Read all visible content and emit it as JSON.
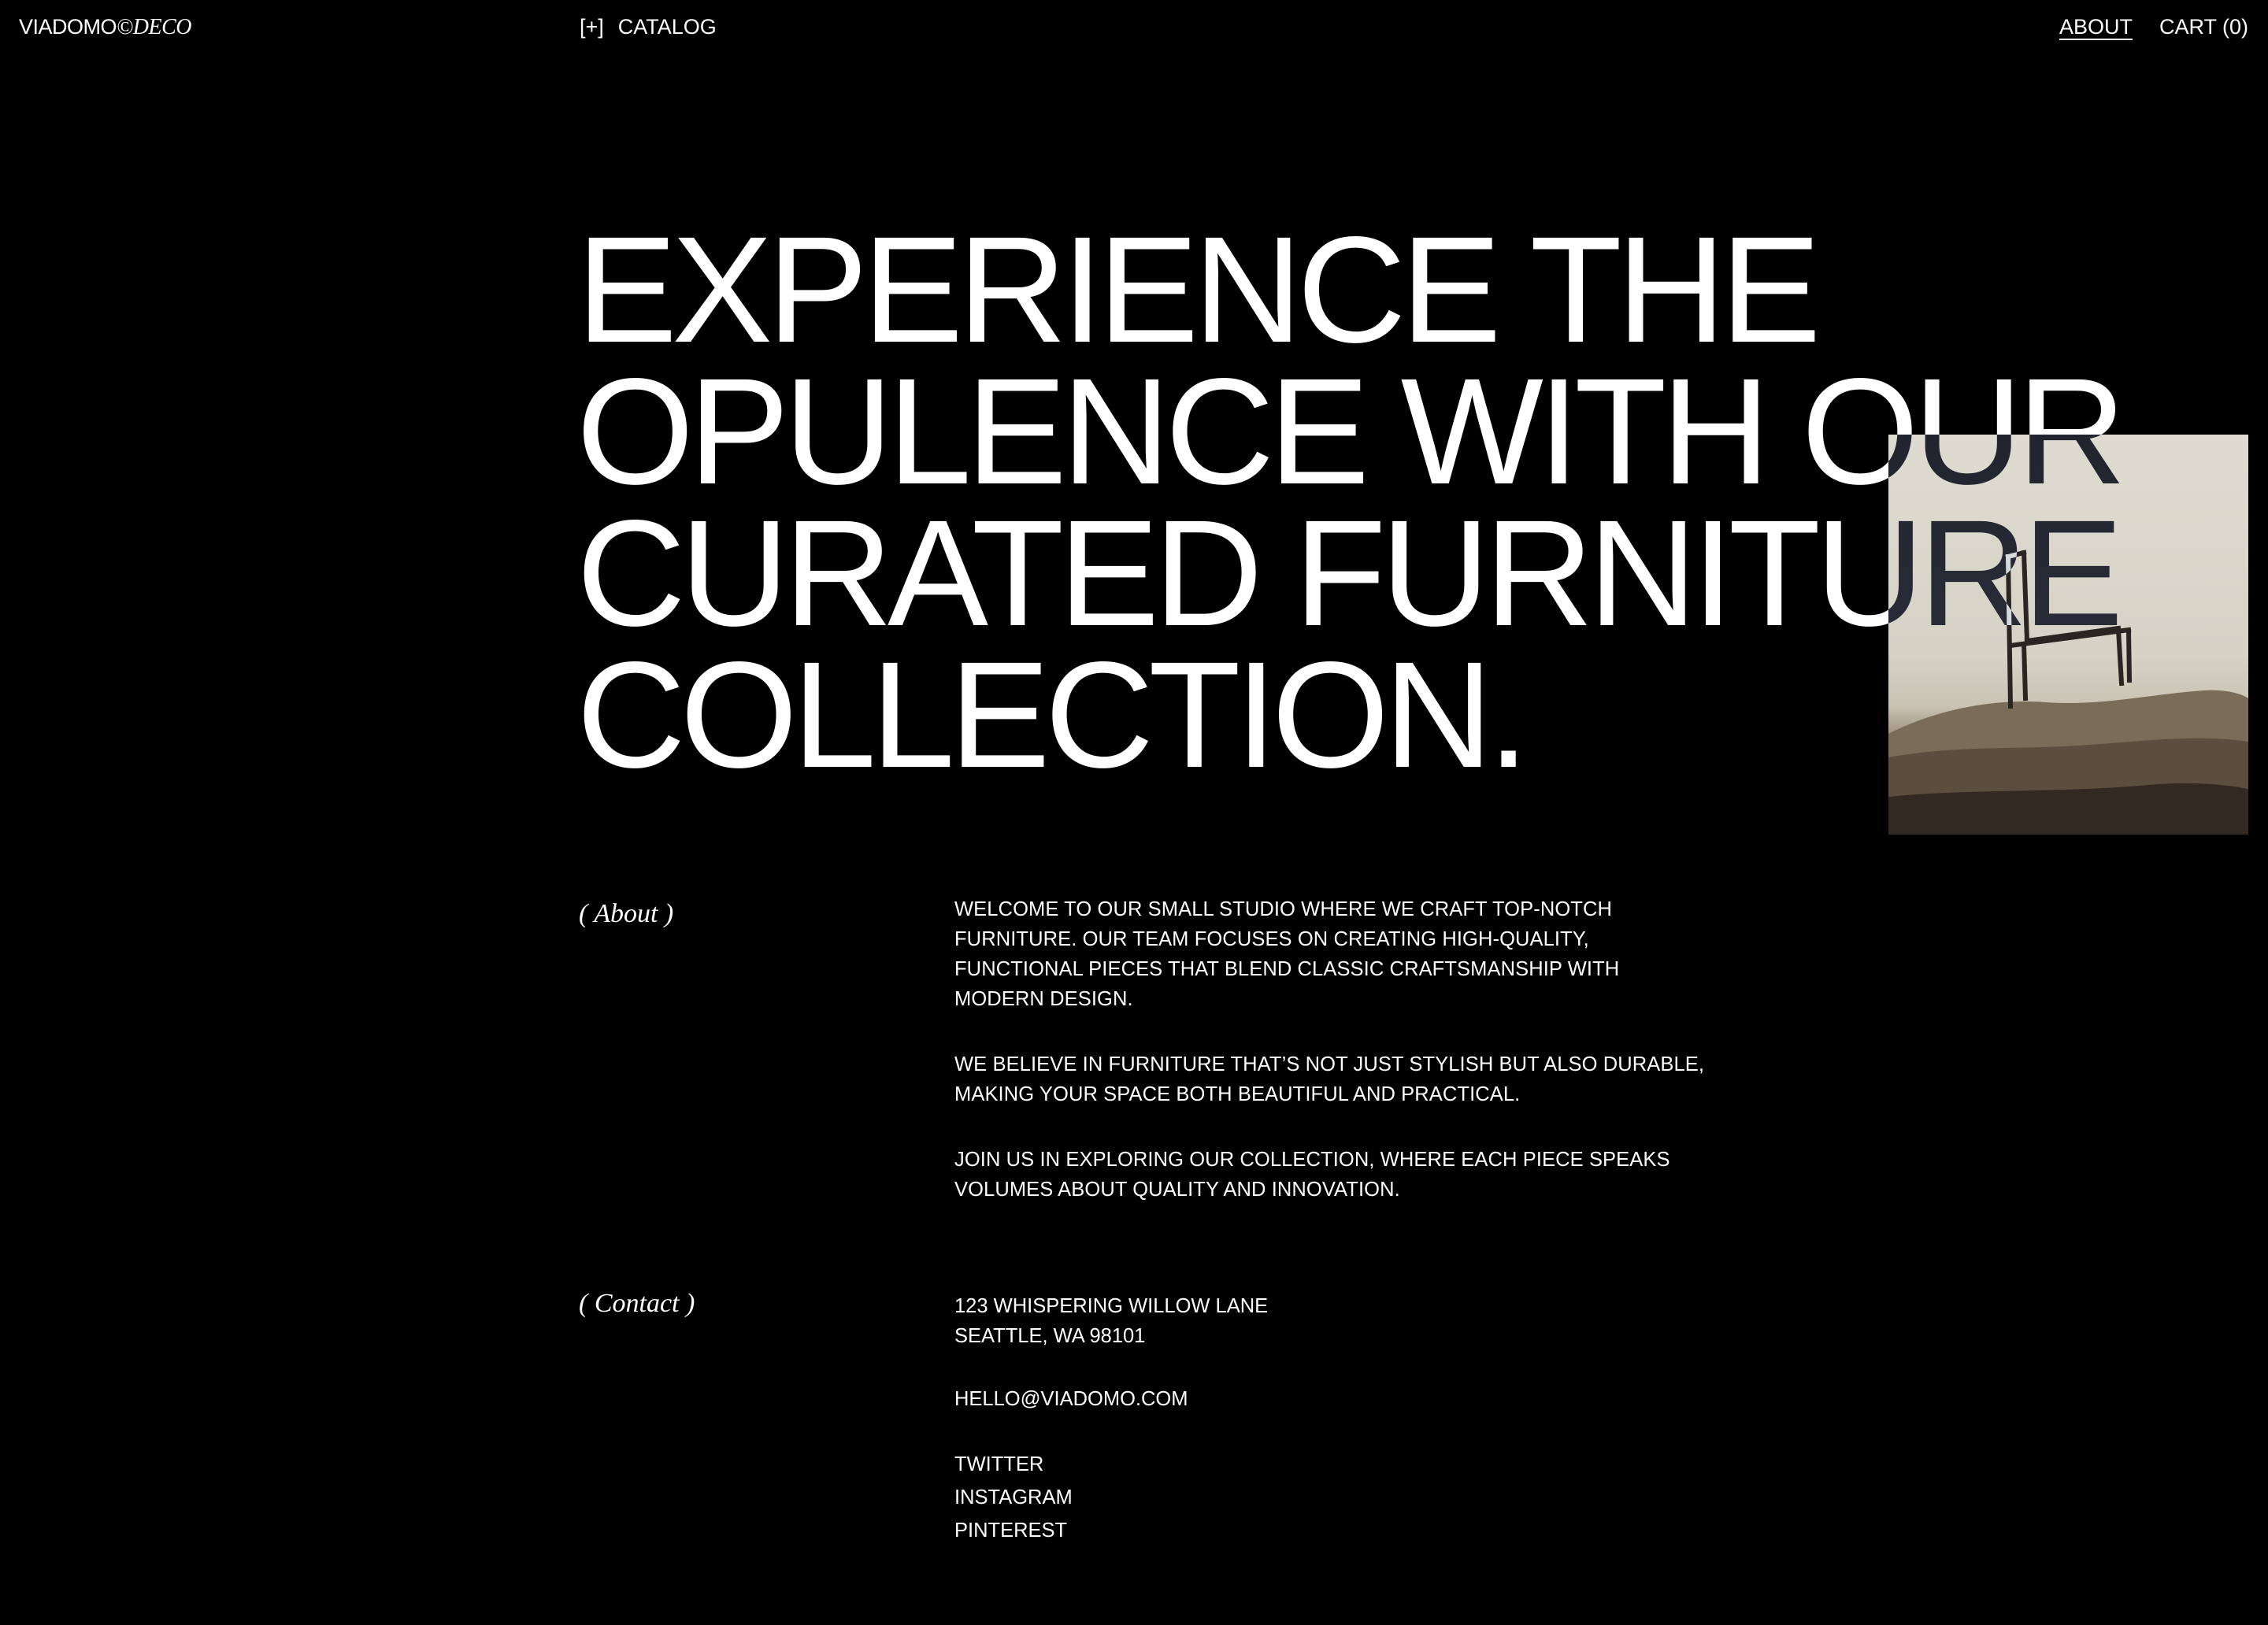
{
  "header": {
    "logo_main": "VIADOMO",
    "logo_sub": "©DECO",
    "catalog_prefix": "[+]",
    "catalog_label": "CATALOG",
    "nav_about": "ABOUT",
    "nav_cart": "CART (0)"
  },
  "hero": {
    "headline_lines": [
      "EXPERIENCE THE",
      "OPULENCE WITH OUR",
      "CURATED FURNITURE",
      "COLLECTION."
    ]
  },
  "about": {
    "label": "( About )",
    "paragraphs": [
      "WELCOME TO OUR SMALL STUDIO WHERE WE CRAFT TOP-NOTCH FURNITURE. OUR TEAM FOCUSES ON CREATING HIGH-QUALITY, FUNCTIONAL PIECES THAT BLEND CLASSIC CRAFTSMANSHIP WITH MODERN DESIGN.",
      "WE BELIEVE IN FURNITURE THAT’S NOT JUST STYLISH BUT ALSO DURABLE, MAKING YOUR SPACE BOTH BEAUTIFUL AND PRACTICAL.",
      "JOIN US IN EXPLORING OUR COLLECTION, WHERE EACH PIECE SPEAKS VOLUMES ABOUT QUALITY AND INNOVATION."
    ]
  },
  "contact": {
    "label": "( Contact )",
    "address_line1": "123 WHISPERING WILLOW LANE",
    "address_line2": "SEATTLE, WA 98101",
    "email": "HELLO@VIADOMO.COM",
    "social": [
      "TWITTER",
      "INSTAGRAM",
      "PINTEREST"
    ]
  },
  "colors": {
    "background": "#000000",
    "text": "#ffffff"
  },
  "icons": {
    "hero_image": "chair-on-rock-photo"
  }
}
